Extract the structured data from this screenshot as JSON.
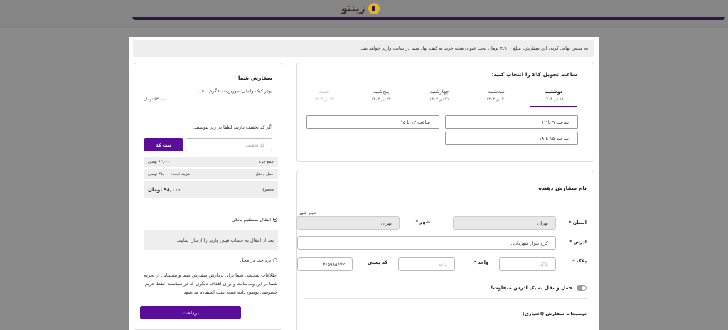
{
  "header": {
    "logo_text": "زینتو"
  },
  "notice": "به محض نهایی کردن این سفارش، مبلغ ۴,۹۰۰ تومان تحت عنوان هدیه خرید به کیف پول شما در سایت واریز خواهد شد.",
  "delivery": {
    "title": "ساعت تحویل کالا را انتخاب کنید:",
    "days": [
      {
        "name": "دوشنبه",
        "date": "۱۹ تیر ۱۴۰۳",
        "state": "active"
      },
      {
        "name": "سه‌شنبه",
        "date": "۲۰ تیر ۱۴۰۳",
        "state": "normal"
      },
      {
        "name": "چهارشنبه",
        "date": "۲۱ تیر ۱۴۰۳",
        "state": "normal"
      },
      {
        "name": "پنج‌شنبه",
        "date": "۲۲ تیر ۱۴۰۳",
        "state": "normal"
      },
      {
        "name": "جمعه",
        "date": "۲۳ تیر ۱۴۰۳",
        "state": "disabled"
      }
    ],
    "slots": [
      "ساعت ۹ تا ۱۲",
      "ساعت ۱۲ تا ۱۵",
      "ساعت ۱۵ تا ۱۸"
    ]
  },
  "sender": {
    "title": "نام سفارش دهنده",
    "change_city_link": "تغییر شهر",
    "province_label": "استان *",
    "province_value": "تهران",
    "city_label": "شهر *",
    "city_value": "تهران",
    "address_label": "ادرس *",
    "address_value": "کرج بلوار شهرداری",
    "plaque_label": "پلاک *",
    "plaque_placeholder": "پلاک",
    "unit_label": "واحد *",
    "unit_placeholder": "واحد",
    "postal_label": "کد پستی",
    "postal_value": "۰۳۶۵۹۸۵۶۳۲",
    "diff_address_label": "حمل و نقل به یک ادرس متفاوت؟",
    "order_notes_label": "توضیحات سفارش (اختیاری)"
  },
  "order": {
    "title": "سفارش شما",
    "item_name": "پودر کیک وانیلی سورین-۵۰۰ گرم",
    "item_qty": "× ۱",
    "item_price": "۶۳,۰۰۰ تومان",
    "coupon_hint": "اگر کد تخفیف دارید، لطفا در زیر بنویسید.",
    "coupon_placeholder": "کد تخفیف",
    "coupon_button": "ثبت کد",
    "subtotal_label": "جمع جزء",
    "subtotal_value": "۶۳,۰۰۰ تومان",
    "shipping_label": "حمل و نقل",
    "shipping_value": "هزینه ثابت: ۳۵,۰۰۰ تومان",
    "total_label": "مجموع",
    "total_value": "۹۸,۰۰۰ تومان",
    "pay_bank_label": "انتقال مستقیم بانکی",
    "pay_bank_desc": "بعد از انتقال به حساب فیش واریز را ارسال نمایید.",
    "pay_cod_label": "پرداخت در محل",
    "privacy_text": "اطلاعات شخصی شما برای پردازش سفارش شما و پشتیبانی از تجربه شما در این وب‌سایت و برای اهداف دیگری که در سیاست حفظ حریم خصوصی توضیح داده شده است استفاده می‌شود.",
    "pay_button": "پرداخت"
  },
  "colors": {
    "accent": "#5a0d99",
    "topline": "#2f1646",
    "overlay": "#8a8a8a"
  }
}
